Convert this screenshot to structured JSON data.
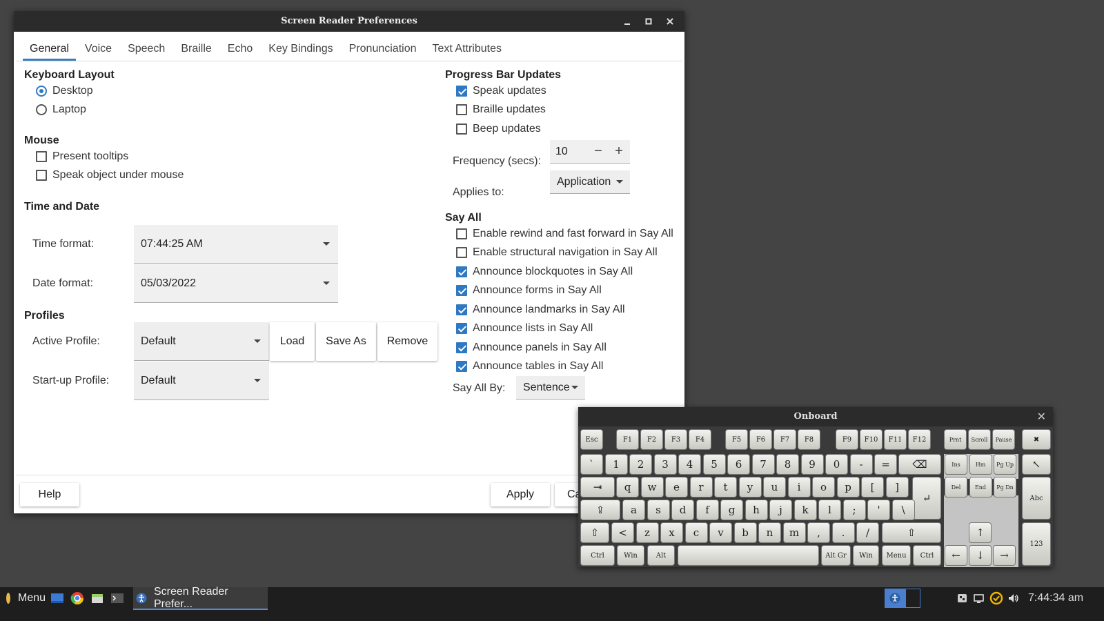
{
  "window": {
    "title": "Screen Reader Preferences",
    "minimize": "–",
    "maximize": "▫",
    "close": "✕"
  },
  "tabs": [
    "General",
    "Voice",
    "Speech",
    "Braille",
    "Echo",
    "Key Bindings",
    "Pronunciation",
    "Text Attributes"
  ],
  "keyboard_layout": {
    "heading": "Keyboard Layout",
    "desktop": "Desktop",
    "laptop": "Laptop",
    "selected": "Desktop"
  },
  "mouse": {
    "heading": "Mouse",
    "present_tooltips": "Present tooltips",
    "speak_object": "Speak object under mouse"
  },
  "time_date": {
    "heading": "Time and Date",
    "time_label": "Time format:",
    "time_value": "07:44:25 AM",
    "date_label": "Date format:",
    "date_value": "05/03/2022"
  },
  "profiles": {
    "heading": "Profiles",
    "active_label": "Active Profile:",
    "active_value": "Default",
    "startup_label": "Start-up Profile:",
    "startup_value": "Default",
    "load": "Load",
    "save_as": "Save As",
    "remove": "Remove"
  },
  "progress": {
    "heading": "Progress Bar Updates",
    "speak": "Speak updates",
    "braille": "Braille updates",
    "beep": "Beep updates",
    "freq_label": "Frequency (secs):",
    "freq_value": "10",
    "minus": "−",
    "plus": "+",
    "applies_label": "Applies to:",
    "applies_value": "Application"
  },
  "say_all": {
    "heading": "Say All",
    "items": [
      "Enable rewind and fast forward in Say All",
      "Enable structural navigation in Say All",
      "Announce blockquotes in Say All",
      "Announce forms in Say All",
      "Announce landmarks in Say All",
      "Announce lists in Say All",
      "Announce panels in Say All",
      "Announce tables in Say All"
    ],
    "by_label": "Say All By:",
    "by_value": "Sentence"
  },
  "footer": {
    "help": "Help",
    "apply": "Apply",
    "cancel": "Ca"
  },
  "onboard": {
    "title": "Onboard",
    "close": "✕",
    "row_fn": [
      "Esc",
      "F1",
      "F2",
      "F3",
      "F4",
      "F5",
      "F6",
      "F7",
      "F8",
      "F9",
      "F10",
      "F11",
      "F12",
      "Prnt",
      "Scroll",
      "Pause"
    ],
    "row_num": [
      "`",
      "1",
      "2",
      "3",
      "4",
      "5",
      "6",
      "7",
      "8",
      "9",
      "0",
      "-",
      "=",
      "⌫"
    ],
    "row_q": [
      "⇥",
      "q",
      "w",
      "e",
      "r",
      "t",
      "y",
      "u",
      "i",
      "o",
      "p",
      "[",
      "]",
      "↵"
    ],
    "row_a": [
      "⇪",
      "a",
      "s",
      "d",
      "f",
      "g",
      "h",
      "j",
      "k",
      "l",
      ";",
      "'",
      "\\"
    ],
    "row_z": [
      "⇧",
      "<",
      "z",
      "x",
      "c",
      "v",
      "b",
      "n",
      "m",
      ",",
      ".",
      "/",
      "⇧"
    ],
    "row_bottom": [
      "Ctrl",
      "Win",
      "Alt",
      "",
      "Alt Gr",
      "Win",
      "Menu",
      "Ctrl"
    ],
    "nav1": [
      "Ins",
      "Hm",
      "Pg Up"
    ],
    "nav2": [
      "Del",
      "End",
      "Pg Dn"
    ],
    "arrows": [
      "↑",
      "←",
      "↓",
      "→"
    ],
    "side": [
      "✖",
      "↖",
      "Abc",
      "123"
    ]
  },
  "taskbar": {
    "menu": "Menu",
    "app": "Screen Reader Prefer...",
    "clock": "7:44:34 am"
  }
}
